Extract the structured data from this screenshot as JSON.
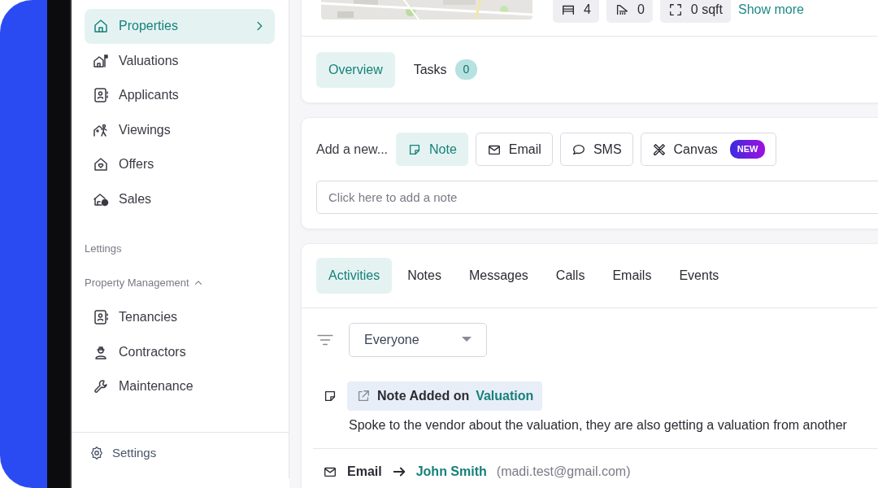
{
  "sidebar": {
    "items": [
      {
        "label": "Properties",
        "selected": true
      },
      {
        "label": "Valuations",
        "selected": false
      },
      {
        "label": "Applicants",
        "selected": false
      },
      {
        "label": "Viewings",
        "selected": false
      },
      {
        "label": "Offers",
        "selected": false
      },
      {
        "label": "Sales",
        "selected": false
      }
    ],
    "sections": [
      {
        "label": "Lettings"
      },
      {
        "label": "Property Management",
        "expanded": true,
        "items": [
          {
            "label": "Tenancies",
            "selected": false
          },
          {
            "label": "Contractors",
            "selected": false
          },
          {
            "label": "Maintenance",
            "selected": false
          }
        ]
      }
    ],
    "footer": {
      "label": "Settings"
    }
  },
  "property": {
    "features": [
      {
        "value": "4"
      },
      {
        "value": "0"
      },
      {
        "value": "0 sqft"
      }
    ],
    "show_more": "Show more"
  },
  "detail_tabs": [
    {
      "label": "Overview",
      "selected": true
    },
    {
      "label": "Tasks",
      "count": "0",
      "selected": false
    }
  ],
  "composer": {
    "prompt": "Add a new...",
    "types": [
      {
        "label": "Note",
        "selected": true
      },
      {
        "label": "Email",
        "selected": false
      },
      {
        "label": "SMS",
        "selected": false
      },
      {
        "label": "Canvas",
        "badge": "NEW",
        "selected": false
      }
    ],
    "input": {
      "placeholder": "Click here to add a note"
    }
  },
  "activity_tabs": [
    {
      "label": "Activities",
      "selected": true
    },
    {
      "label": "Notes",
      "selected": false
    },
    {
      "label": "Messages",
      "selected": false
    },
    {
      "label": "Calls",
      "selected": false
    },
    {
      "label": "Emails",
      "selected": false
    },
    {
      "label": "Events",
      "selected": false
    }
  ],
  "filter": {
    "value": "Everyone"
  },
  "activities": [
    {
      "kind": "note",
      "title": "Note Added on",
      "link": "Valuation",
      "text": "Spoke to the vendor about the valuation, they are also getting a valuation from another"
    },
    {
      "kind": "email",
      "title": "Email",
      "recipient": "John Smith",
      "address": "(madi.test@gmail.com)"
    }
  ]
}
